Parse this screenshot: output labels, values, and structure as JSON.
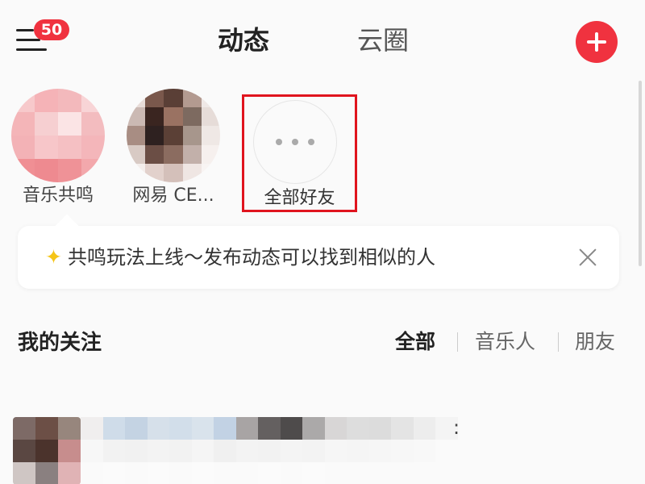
{
  "header": {
    "badge_count": "50",
    "tabs": [
      {
        "label": "动态",
        "active": true
      },
      {
        "label": "云圈",
        "active": false
      }
    ],
    "accent_color": "#f0323f"
  },
  "friends": [
    {
      "name": "音乐共鸣"
    },
    {
      "name": "网易 CE..."
    },
    {
      "name": "全部好友",
      "highlighted": true
    }
  ],
  "tip": {
    "text": "共鸣玩法上线～发布动态可以找到相似的人"
  },
  "following": {
    "title": "我的关注",
    "filters": [
      {
        "label": "全部",
        "active": true
      },
      {
        "label": "音乐人",
        "active": false
      },
      {
        "label": "朋友",
        "active": false
      }
    ]
  },
  "feed": {
    "colon": ":"
  },
  "icons": {
    "menu": "menu-icon",
    "add": "plus-icon",
    "more": "more-dots-icon",
    "close": "close-icon",
    "tip": "star-icon"
  }
}
